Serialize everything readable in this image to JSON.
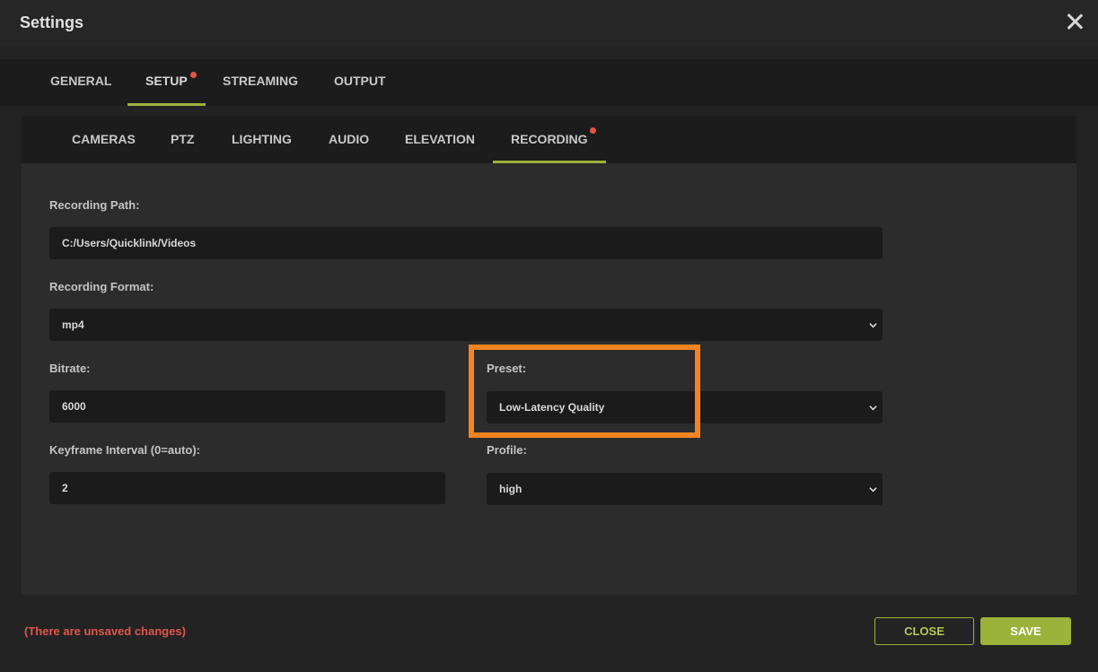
{
  "window": {
    "title": "Settings"
  },
  "main_tabs": [
    "GENERAL",
    "SETUP",
    "STREAMING",
    "OUTPUT"
  ],
  "sub_tabs": [
    "CAMERAS",
    "PTZ",
    "LIGHTING",
    "AUDIO",
    "ELEVATION",
    "RECORDING"
  ],
  "form": {
    "recording_path": {
      "label": "Recording Path:",
      "value": "C:/Users/Quicklink/Videos"
    },
    "recording_format": {
      "label": "Recording Format:",
      "value": "mp4"
    },
    "bitrate": {
      "label": "Bitrate:",
      "value": "6000"
    },
    "preset": {
      "label": "Preset:",
      "value": "Low-Latency Quality"
    },
    "keyframe_interval": {
      "label": "Keyframe Interval (0=auto):",
      "value": "2"
    },
    "profile": {
      "label": "Profile:",
      "value": "high"
    }
  },
  "footer": {
    "unsaved_text": "(There are unsaved changes)",
    "close_label": "CLOSE",
    "save_label": "SAVE"
  },
  "colors": {
    "accent": "#9db23a",
    "alert": "#e55348",
    "highlight": "#f38420"
  }
}
